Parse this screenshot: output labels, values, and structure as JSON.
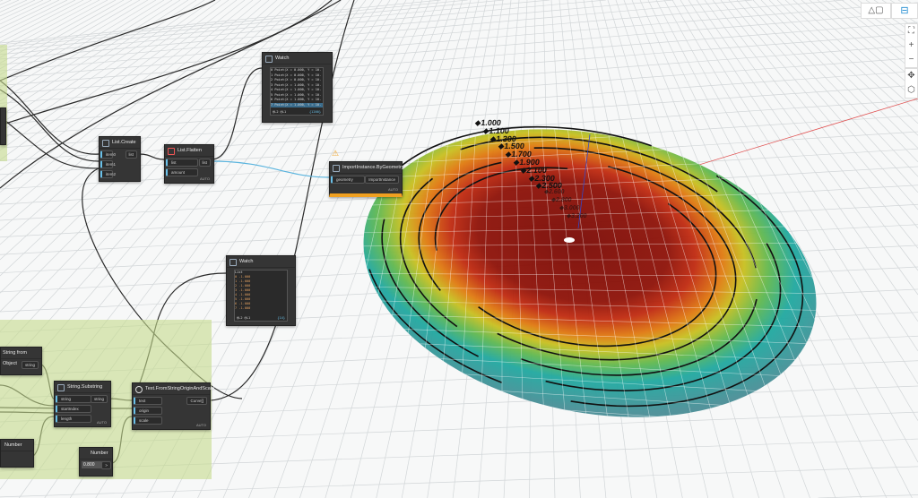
{
  "nodes": {
    "list_create": {
      "title": "List.Create",
      "inputs": [
        "item0",
        "item1",
        "item2"
      ],
      "output": "list"
    },
    "list_flatten": {
      "title": "List.Flatten",
      "inputs": [
        "list",
        "amount"
      ],
      "output": "list",
      "lacing": "AUTO"
    },
    "watch_top": {
      "title": "Watch",
      "items": [
        "0 Point(X = 0.000, Y = 10.",
        "1 Point(X = 0.000, Y = 10.",
        "2 Point(X = 0.000, Y = 10.",
        "3 Point(X = 1.000, Y = 10.",
        "4 Point(X = 1.000, Y = 10.",
        "5 Point(X = 1.000, Y = 10.",
        "6 Point(X = 1.000, Y = 10.",
        "7 Point(X = 1.000, Y = 10."
      ],
      "footer_left": "@L2 @L1",
      "footer_right": "{1200}"
    },
    "import_instance": {
      "title": "ImportInstance.ByGeometry",
      "input": "geometry",
      "output": "ImportInstance",
      "lacing": "AUTO",
      "warning": "⚠"
    },
    "watch_mid": {
      "title": "Watch",
      "header": "List",
      "items": [
        "0 -1.000",
        "1 -1.000",
        "2 -1.000",
        "3 -1.000",
        "4 -1.000",
        "5 -1.000",
        "6 -1.000",
        "7 -1.000"
      ],
      "footer_left": "@L2 @L1",
      "footer_right": "{14}"
    },
    "string_from_object": {
      "title": "String from Object",
      "output": "string"
    },
    "string_substring": {
      "title": "String.Substring",
      "inputs": [
        "string",
        "startIndex",
        "length"
      ],
      "output": "string",
      "lacing": "AUTO"
    },
    "text_from_string": {
      "title": "Text.FromStringOriginAndScale",
      "inputs": [
        "text",
        "origin",
        "scale"
      ],
      "output": "Curve[]",
      "lacing": "AUTO"
    },
    "number": {
      "title": "Number",
      "value": "0.800",
      "output": ">"
    },
    "number_left": {
      "title": "Number"
    }
  },
  "contour_labels": [
    "1.000",
    "1.100",
    "1.300",
    "1.500",
    "1.700",
    "1.900",
    "2.100",
    "2.300",
    "2.500",
    "2.600",
    "2.800",
    "3.000",
    "3.200"
  ],
  "toolbar": {
    "geometry_view": "△▢",
    "graph_view": "⊟",
    "zoom_fit": "⛶",
    "zoom_in": "+",
    "zoom_out": "−",
    "pan": "✥",
    "orbit": "⬡"
  },
  "colors": {
    "group": "#c4da8c",
    "node": "#353535",
    "wire_selected": "#5ab4de",
    "warning": "#f0a020"
  }
}
